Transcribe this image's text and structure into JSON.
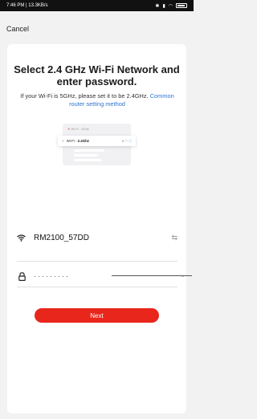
{
  "status_bar": {
    "time_speed": "7:46 PM | 13.3KB/s"
  },
  "header": {
    "cancel_label": "Cancel"
  },
  "title": "Select 2.4 GHz Wi-Fi Network and enter password.",
  "subtitle": "If your Wi-Fi is 5GHz, please set it to be 2.4GHz.",
  "subtitle_link": "Common router setting method",
  "illustration": {
    "row1": "Wi-Fi - 5Ghz",
    "row2_prefix": "Wi-Fi -",
    "row2_bold": "2.4Ghz"
  },
  "network": {
    "ssid": "RM2100_57DD"
  },
  "password": {
    "masked": "·········"
  },
  "next_label": "Next",
  "colors": {
    "accent": "#e8261c",
    "link": "#2b74d4"
  }
}
